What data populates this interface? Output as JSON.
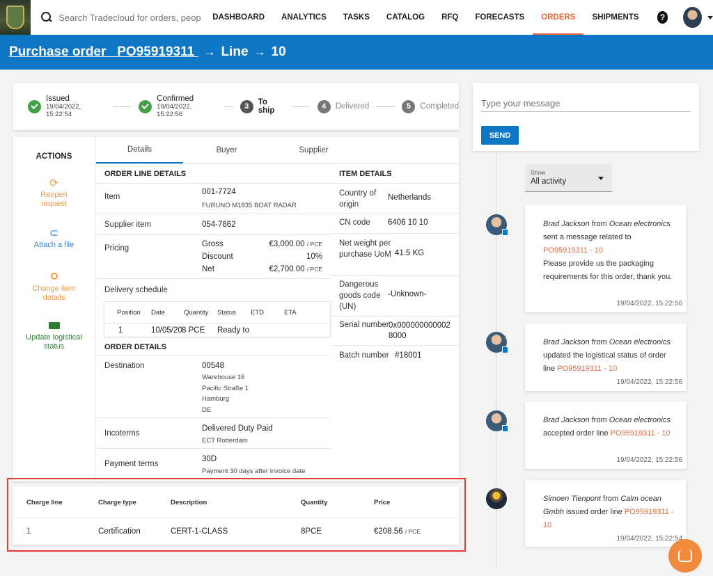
{
  "nav": {
    "search_placeholder": "Search Tradecloud for orders, people, c...",
    "links": [
      "DASHBOARD",
      "ANALYTICS",
      "TASKS",
      "CATALOG",
      "RFQ",
      "FORECASTS",
      "ORDERS",
      "SHIPMENTS"
    ],
    "active": "ORDERS",
    "help": "?"
  },
  "breadcrumb": {
    "order_link": "Purchase order   PO95919311 ",
    "line": "Line",
    "number": "10"
  },
  "stepper": [
    {
      "label": "Issued",
      "date": "19/04/2022, 15:22:54",
      "state": "done"
    },
    {
      "label": "Confirmed",
      "date": "19/04/2022, 15:22:56",
      "state": "done"
    },
    {
      "label": "To ship",
      "num": "3",
      "state": "current"
    },
    {
      "label": "Delivered",
      "num": "4",
      "state": "todo"
    },
    {
      "label": "Completed",
      "num": "5",
      "state": "todo"
    }
  ],
  "actions": {
    "title": "ACTIONS",
    "items": [
      {
        "label": "Reopen request",
        "icon": "refresh-icon"
      },
      {
        "label": "Attach a file",
        "icon": "paperclip-icon"
      },
      {
        "label": "Change item details",
        "icon": "gear-icon"
      },
      {
        "label": "Update logistical status",
        "icon": "truck-icon"
      }
    ]
  },
  "tabs": [
    "Details",
    "Buyer",
    "Supplier"
  ],
  "order_line": {
    "title": "ORDER LINE DETAILS",
    "item_label": "Item",
    "item_code": "001-7724",
    "item_name": "FURUNO M1835 BOAT RADAR",
    "supplier_item_label": "Supplier item",
    "supplier_item": "054-7862",
    "pricing_label": "Pricing",
    "gross_label": "Gross",
    "gross_value": "€3,000.00",
    "discount_label": "Discount",
    "discount_value": "10%",
    "net_label": "Net",
    "net_value": "€2,700.00",
    "per_unit": "/ PCE",
    "delivery_label": "Delivery schedule",
    "schedule_headers": [
      "Position",
      "Date",
      "Quantity",
      "Status",
      "ETD",
      "ETA"
    ],
    "schedule_row": [
      "1",
      "10/05/20",
      "8 PCE",
      "Ready to S"
    ]
  },
  "item_details": {
    "title": "ITEM DETAILS",
    "country_label": "Country of origin",
    "country": "Netherlands",
    "cn_label": "CN code",
    "cn": "6406 10 10",
    "weight_label": "Net weight per purchase UoM",
    "weight": "41.5 KG",
    "dangerous_label": "Dangerous goods code (UN)",
    "dangerous": "-Unknown-",
    "serial_label": "Serial number",
    "serial": "0x0000000000028000",
    "batch_label": "Batch number",
    "batch": "#18001"
  },
  "order_details": {
    "title": "ORDER DETAILS",
    "destination_label": "Destination",
    "destination_code": "00548",
    "address": [
      "Warehouse 16",
      "Pacific Straße 1",
      "Hamburg",
      "DE"
    ],
    "incoterms_label": "Incoterms",
    "incoterms": "Delivered Duty Paid",
    "incoterms_place": "ECT Rotterdam",
    "payment_label": "Payment terms",
    "payment": "30D",
    "payment_desc": "Payment 30 days after invoice date"
  },
  "charges": {
    "headers": [
      "Charge line",
      "Charge type",
      "Description",
      "Quantity",
      "Price"
    ],
    "row": {
      "line": "1",
      "type": "Certification",
      "description": "CERT-1-CLASS",
      "quantity": "8PCE",
      "price": "€208.56",
      "unit": "/ PCE"
    }
  },
  "message": {
    "placeholder": "Type your message",
    "send": "SEND"
  },
  "filter": {
    "label": "Show",
    "value": "All activity"
  },
  "activity": [
    {
      "actor": "Brad Jackson",
      "from": "from",
      "company": "Ocean electronics",
      "text": "sent a message related to",
      "link": "PO95919311 - 10",
      "extra": "Please provide us the packaging requirements for this order, thank you.",
      "time": "19/04/2022, 15:22:56"
    },
    {
      "actor": "Brad Jackson",
      "from": "from",
      "company": "Ocean electronics",
      "text": "updated the logistical status of order line",
      "link": "PO95919311 - 10",
      "time": "19/04/2022, 15:22:56"
    },
    {
      "actor": "Brad Jackson",
      "from": "from",
      "company": "Ocean electronics",
      "text": "accepted order line",
      "link": "PO95919311 - 10",
      "time": "19/04/2022, 15:22:56"
    },
    {
      "actor": "Simoen Tienpont",
      "from": "from",
      "company": "Calm ocean Gmbh",
      "text": "issued order line",
      "link": "PO95919311 - 10",
      "time": "19/04/2022, 15:22:54"
    }
  ]
}
